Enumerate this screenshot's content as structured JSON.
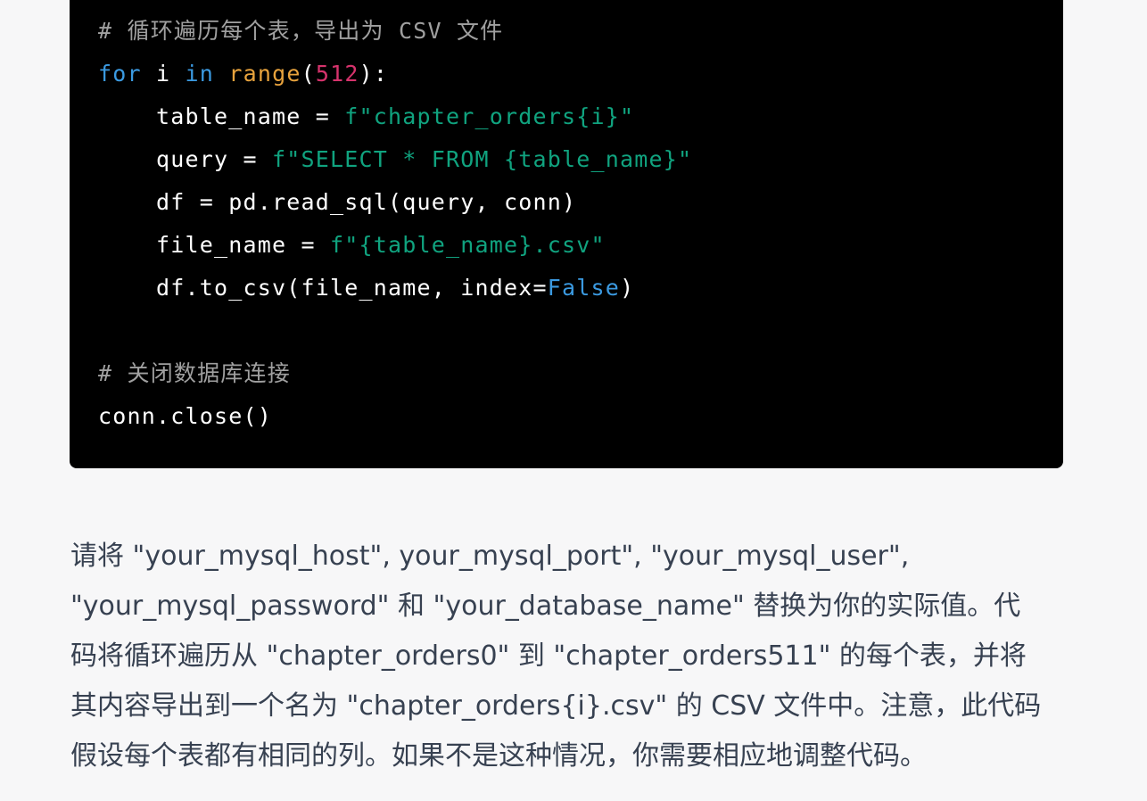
{
  "code_block": {
    "lines": [
      [
        {
          "t": "cmt",
          "v": "# 循环遍历每个表，导出为 CSV 文件"
        }
      ],
      [
        {
          "t": "kw",
          "v": "for"
        },
        {
          "t": "plain",
          "v": " i "
        },
        {
          "t": "kw",
          "v": "in"
        },
        {
          "t": "plain",
          "v": " "
        },
        {
          "t": "fn",
          "v": "range"
        },
        {
          "t": "plain",
          "v": "("
        },
        {
          "t": "num",
          "v": "512"
        },
        {
          "t": "plain",
          "v": "):"
        }
      ],
      [
        {
          "t": "plain",
          "v": "    table_name = "
        },
        {
          "t": "str",
          "v": "f\"chapter_orders{i}\""
        }
      ],
      [
        {
          "t": "plain",
          "v": "    query = "
        },
        {
          "t": "str",
          "v": "f\"SELECT * FROM {table_name}\""
        }
      ],
      [
        {
          "t": "plain",
          "v": "    df = pd.read_sql(query, conn)"
        }
      ],
      [
        {
          "t": "plain",
          "v": "    file_name = "
        },
        {
          "t": "str",
          "v": "f\"{table_name}.csv\""
        }
      ],
      [
        {
          "t": "plain",
          "v": "    df.to_csv(file_name, index="
        },
        {
          "t": "kw",
          "v": "False"
        },
        {
          "t": "plain",
          "v": ")"
        }
      ],
      [],
      [
        {
          "t": "cmt",
          "v": "# 关闭数据库连接"
        }
      ],
      [
        {
          "t": "plain",
          "v": "conn.close()"
        }
      ]
    ]
  },
  "message": {
    "lines": [
      "请将 \"your_mysql_host\", your_mysql_port\", \"your_mysql_user\",",
      "\"your_mysql_password\" 和 \"your_database_name\" 替换为你的实际值。代",
      "码将循环遍历从 \"chapter_orders0\" 到 \"chapter_orders511\" 的每个表，并将",
      "其内容导出到一个名为 \"chapter_orders{i}.csv\" 的 CSV 文件中。注意，此代码",
      "假设每个表都有相同的列。如果不是这种情况，你需要相应地调整代码。"
    ]
  }
}
